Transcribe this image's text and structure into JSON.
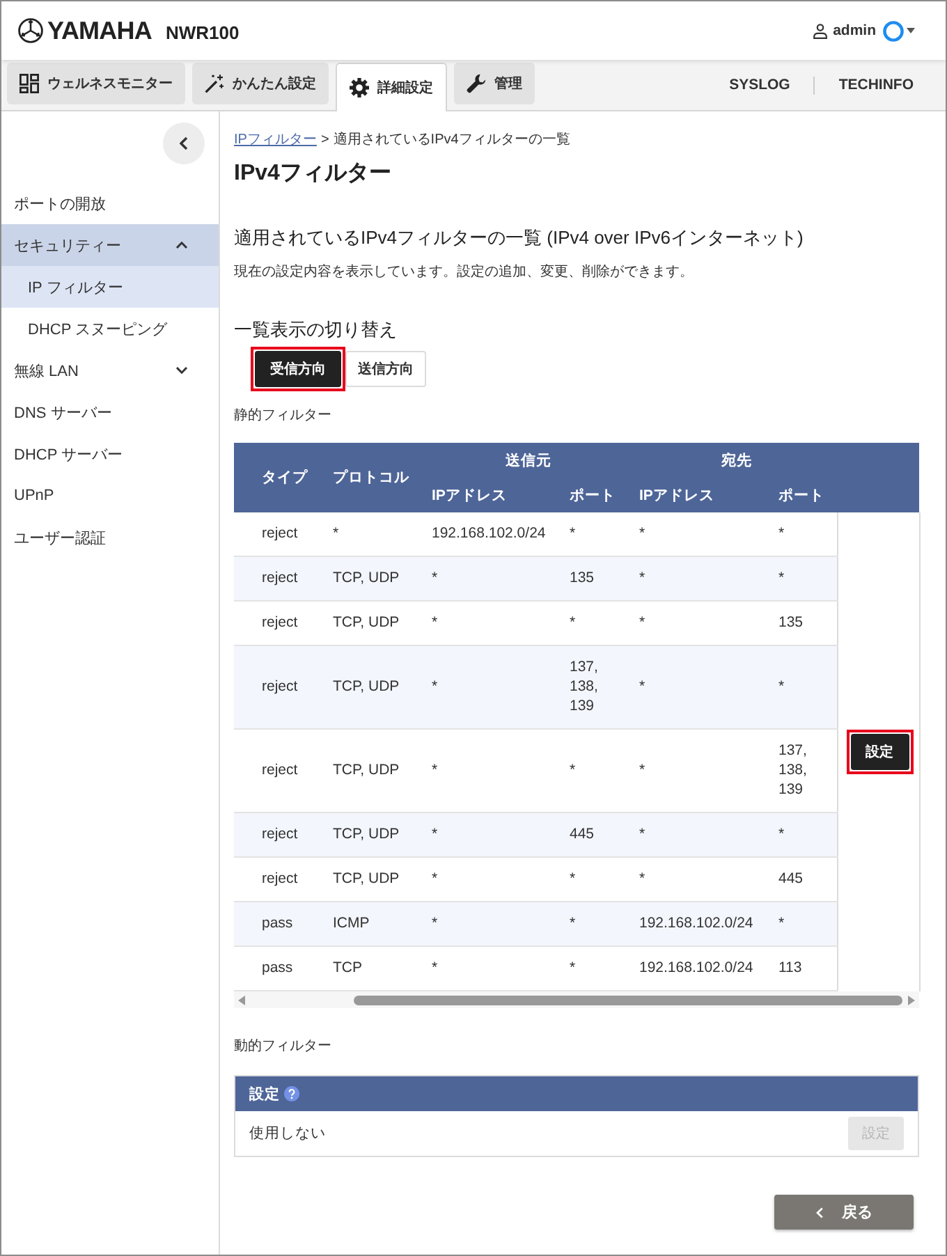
{
  "header": {
    "brand": "YAMAHA",
    "model": "NWR100",
    "user": "admin"
  },
  "nav": {
    "tabs": [
      {
        "label": "ウェルネスモニター",
        "selected": false
      },
      {
        "label": "かんたん設定",
        "selected": false
      },
      {
        "label": "詳細設定",
        "selected": true
      },
      {
        "label": "管理",
        "selected": false
      }
    ],
    "links": [
      "SYSLOG",
      "TECHINFO"
    ]
  },
  "sidebar": {
    "items": [
      {
        "kind": "link",
        "label": "ポートの開放",
        "selected": false
      },
      {
        "kind": "group",
        "label": "セキュリティー",
        "selected": true,
        "expanded": true,
        "children": [
          {
            "label": "IP フィルター",
            "selected": true
          },
          {
            "label": "DHCP スヌーピング",
            "selected": false
          }
        ]
      },
      {
        "kind": "group",
        "label": "無線 LAN",
        "selected": false,
        "expanded": false
      },
      {
        "kind": "link",
        "label": "DNS サーバー",
        "selected": false
      },
      {
        "kind": "link",
        "label": "DHCP サーバー",
        "selected": false
      },
      {
        "kind": "link",
        "label": "UPnP",
        "selected": false
      },
      {
        "kind": "link",
        "label": "ユーザー認証",
        "selected": false
      }
    ]
  },
  "breadcrumb": {
    "link": "IPフィルター",
    "separator": ">",
    "current": "適用されているIPv4フィルターの一覧"
  },
  "title": "IPv4フィルター",
  "section": {
    "heading": "適用されているIPv4フィルターの一覧 (IPv4 over IPv6インターネット)",
    "description": "現在の設定内容を表示しています。設定の追加、変更、削除ができます。"
  },
  "view_switch": {
    "label": "一覧表示の切り替え",
    "options": [
      {
        "label": "受信方向",
        "selected": true,
        "highlighted": true
      },
      {
        "label": "送信方向",
        "selected": false,
        "highlighted": false
      }
    ]
  },
  "static_filter": {
    "label": "静的フィルター",
    "header": [
      {
        "label": "タイプ"
      },
      {
        "label": "プロトコル"
      },
      {
        "label": "送信元",
        "children": [
          "IPアドレス",
          "ポート"
        ]
      },
      {
        "label": "宛先",
        "children": [
          "IPアドレス",
          "ポート"
        ]
      }
    ],
    "rows": [
      {
        "cells": [
          "reject",
          "*",
          "192.168.102.0/24",
          "*",
          "*",
          "*"
        ]
      },
      {
        "cells": [
          "reject",
          "TCP, UDP",
          "*",
          "135",
          "*",
          "*"
        ]
      },
      {
        "cells": [
          "reject",
          "TCP, UDP",
          "*",
          "*",
          "*",
          "135"
        ]
      },
      {
        "cells": [
          "reject",
          "TCP, UDP",
          "*",
          "137, 138, 139",
          "*",
          "*"
        ]
      },
      {
        "cells": [
          "reject",
          "TCP, UDP",
          "*",
          "*",
          "*",
          "137, 138, 139"
        ],
        "button": {
          "label": "設定",
          "highlighted": true
        }
      },
      {
        "cells": [
          "reject",
          "TCP, UDP",
          "*",
          "445",
          "*",
          "*"
        ]
      },
      {
        "cells": [
          "reject",
          "TCP, UDP",
          "*",
          "*",
          "*",
          "445"
        ]
      },
      {
        "cells": [
          "pass",
          "ICMP",
          "*",
          "*",
          "192.168.102.0/24",
          "*"
        ]
      },
      {
        "cells": [
          "pass",
          "TCP",
          "*",
          "*",
          "192.168.102.0/24",
          "113"
        ]
      }
    ]
  },
  "dynamic_filter": {
    "label": "動的フィルター",
    "header": "設定",
    "value": "使用しない",
    "button": {
      "label": "設定",
      "disabled": true
    }
  },
  "back_button": {
    "label": "戻る"
  }
}
